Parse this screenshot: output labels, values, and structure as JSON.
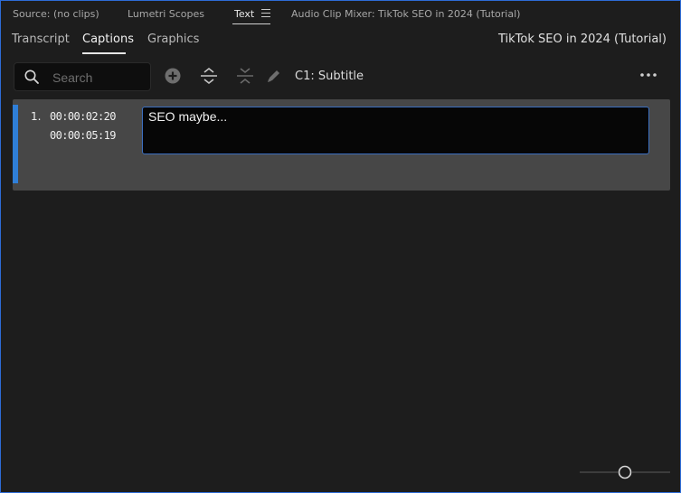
{
  "panel_tabs": [
    {
      "label": "Source: (no clips)"
    },
    {
      "label": "Lumetri Scopes"
    },
    {
      "label": "Text"
    },
    {
      "label": "Audio Clip Mixer: TikTok SEO in 2024 (Tutorial)"
    }
  ],
  "subtabs": [
    {
      "label": "Transcript"
    },
    {
      "label": "Captions"
    },
    {
      "label": "Graphics"
    }
  ],
  "sequence_title": "TikTok SEO in 2024 (Tutorial)",
  "search": {
    "placeholder": "Search",
    "value": ""
  },
  "toolbar": {
    "icons": [
      "add-icon",
      "expand-icon",
      "collapse-icon",
      "pencil-icon"
    ],
    "track_label": "C1: Subtitle",
    "more_icon": "more-icon"
  },
  "captions": [
    {
      "index": "1.",
      "in": "00:00:02:20",
      "out": "00:00:05:19",
      "text": "SEO maybe..."
    }
  ],
  "colors": {
    "accent": "#2f7fd8",
    "row_bg": "#474747",
    "panel_bg": "#1d1d1d"
  }
}
